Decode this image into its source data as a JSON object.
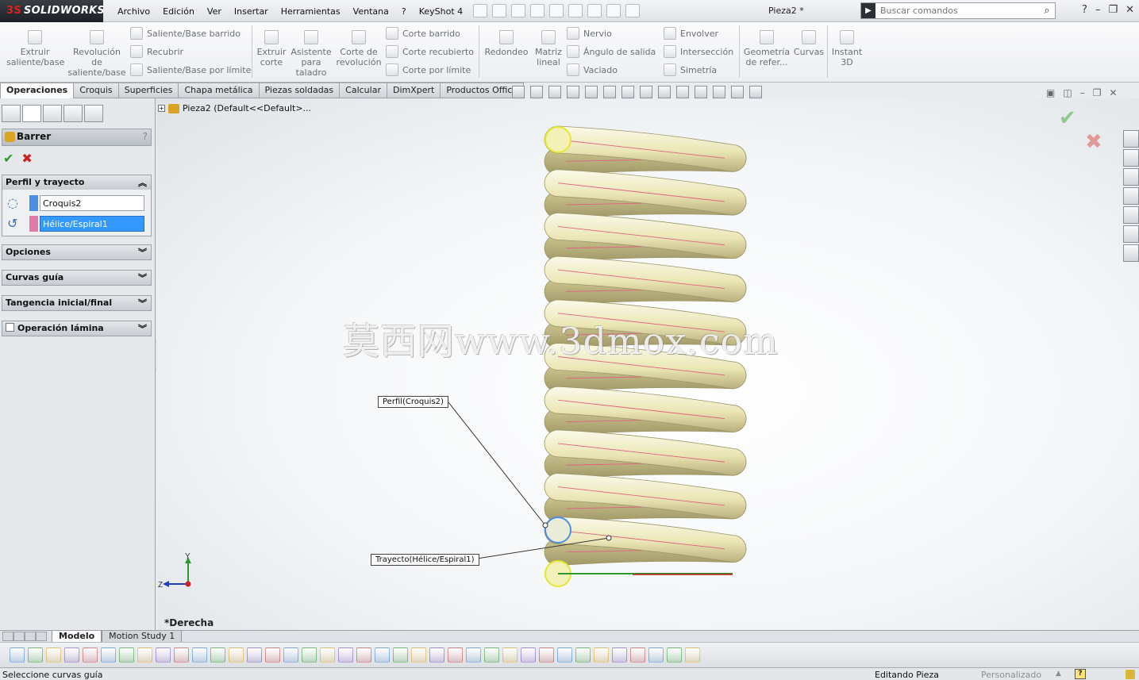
{
  "app": {
    "logo_text": "SOLIDWORKS",
    "document_title": "Pieza2 *"
  },
  "menu": [
    "Archivo",
    "Edición",
    "Ver",
    "Insertar",
    "Herramientas",
    "Ventana",
    "?",
    "KeyShot 4"
  ],
  "search": {
    "placeholder": "Buscar comandos"
  },
  "commands": {
    "extrude_boss": "Extruir saliente/base",
    "revolve_boss": "Revolución de saliente/base",
    "swept_boss": "Saliente/Base barrido",
    "lofted_boss": "Recubrir",
    "boundary_boss": "Saliente/Base por límite",
    "extrude_cut": "Extruir corte",
    "hole_wizard": "Asistente para taladro",
    "revolve_cut": "Corte de revolución",
    "swept_cut": "Corte barrido",
    "lofted_cut": "Corte recubierto",
    "boundary_cut": "Corte por límite",
    "fillet": "Redondeo",
    "linear_pattern": "Matriz lineal",
    "rib": "Nervio",
    "draft": "Ángulo de salida",
    "shell": "Vaciado",
    "wrap": "Envolver",
    "intersect": "Intersección",
    "mirror": "Simetría",
    "ref_geometry": "Geometría de refer...",
    "curves": "Curvas",
    "instant3d": "Instant 3D"
  },
  "tabs": [
    "Operaciones",
    "Croquis",
    "Superficies",
    "Chapa metálica",
    "Piezas soldadas",
    "Calcular",
    "DimXpert",
    "Productos Office"
  ],
  "property_manager": {
    "title": "Barrer",
    "help": "?",
    "profile_group": {
      "label": "Perfil y trayecto",
      "profile_value": "Croquis2",
      "path_value": "Hélice/Espiral1"
    },
    "groups": [
      "Opciones",
      "Curvas guía",
      "Tangencia inicial/final",
      "Operación lámina"
    ]
  },
  "tree": {
    "part_label": "Pieza2  (Default<<Default>..."
  },
  "viewport": {
    "view_name": "*Derecha",
    "callout_profile": "Perfil(Croquis2)",
    "callout_path": "Trayecto(Hélice/Espiral1)",
    "watermark": "莫西网www.3dmox.com",
    "triad_y": "Y",
    "triad_z": "Z"
  },
  "bottom_tabs": [
    "Modelo",
    "Motion Study 1"
  ],
  "status": {
    "message": "Seleccione curvas guía",
    "mode": "Editando Pieza",
    "units": "Personalizado",
    "help": "?"
  },
  "colors": {
    "spring_fill": "#efebbf",
    "helix_line": "#e06080",
    "selected_input": "#3399ff",
    "profile_swatch": "#4a90e2",
    "path_swatch": "#e07aa8"
  }
}
